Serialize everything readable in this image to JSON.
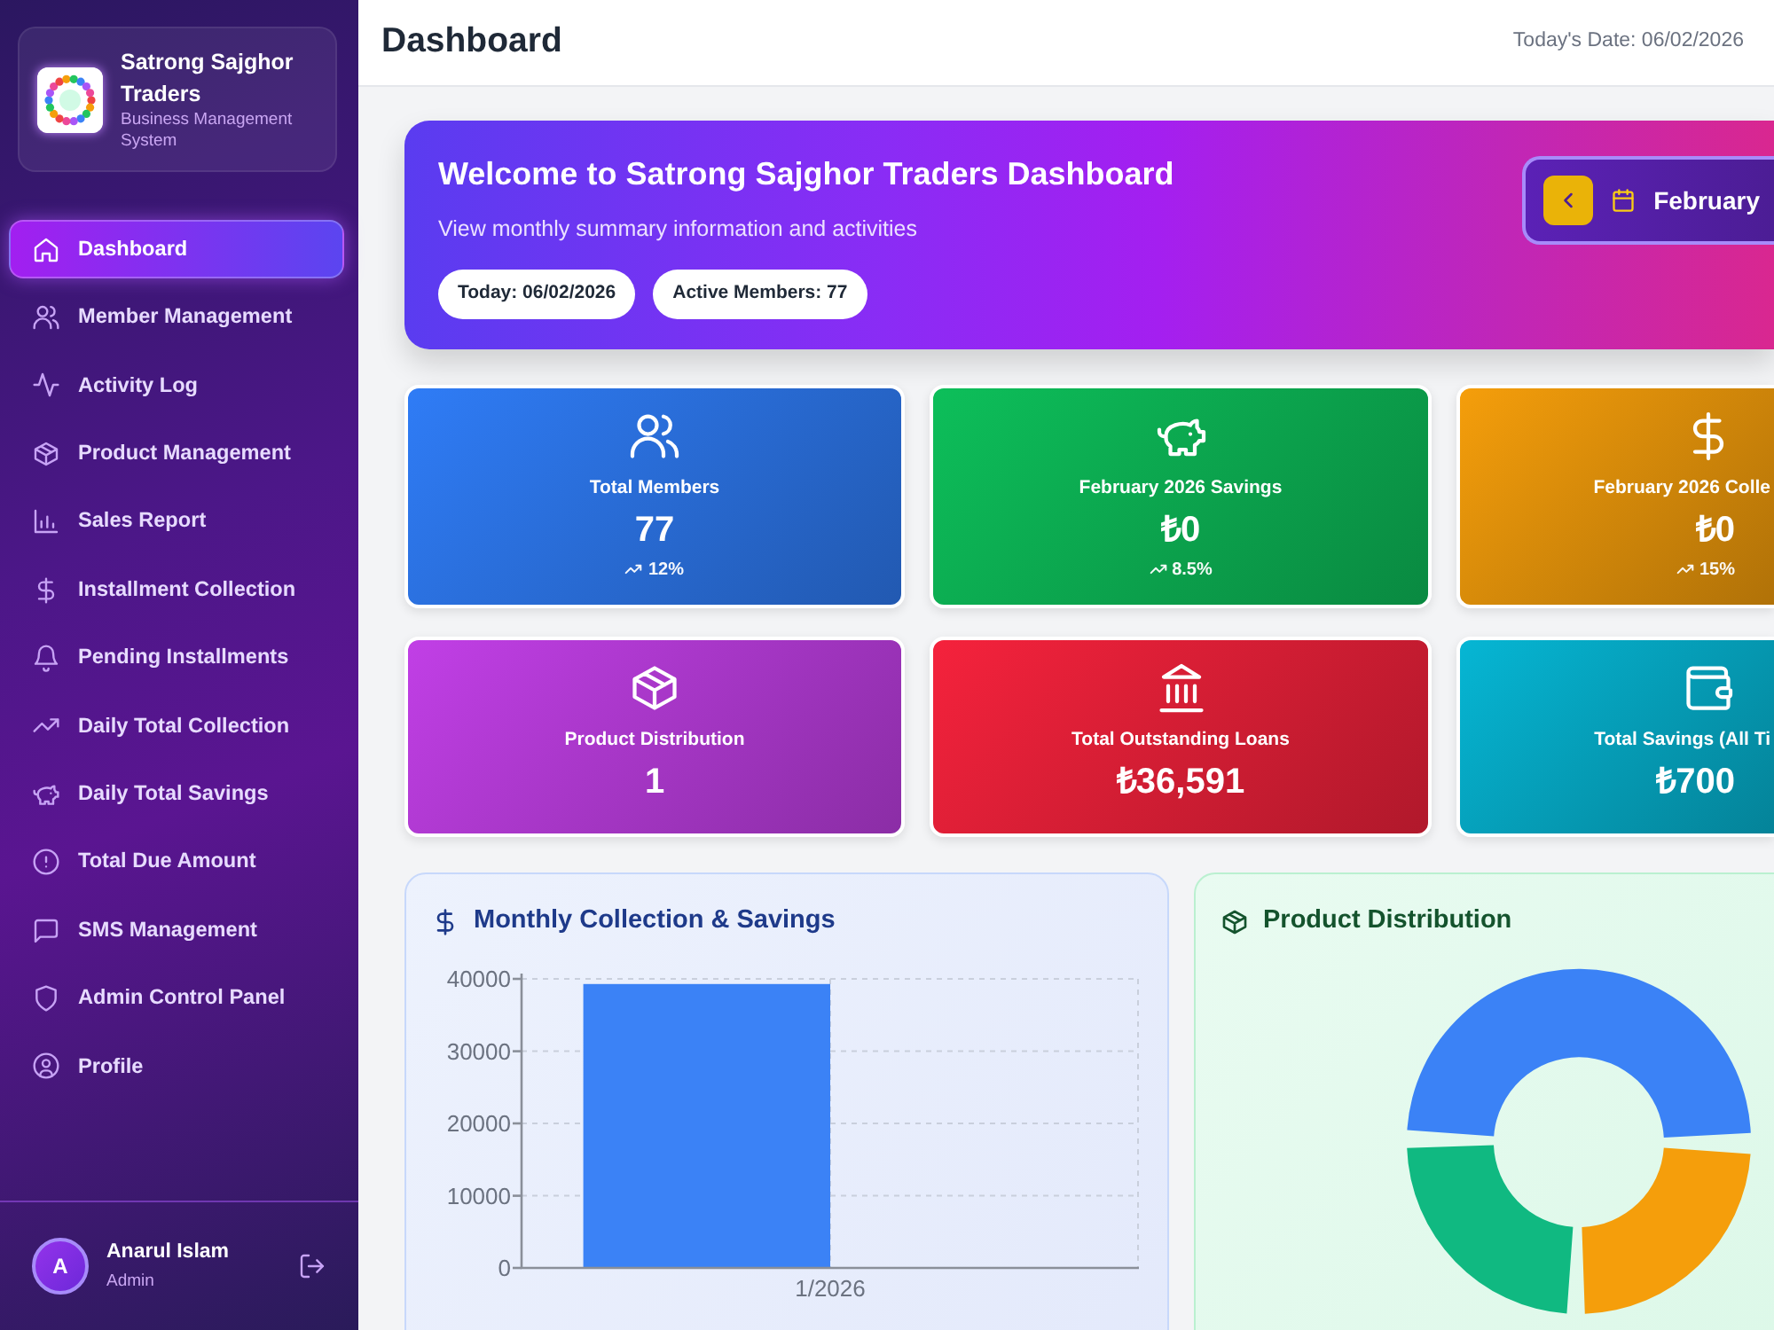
{
  "sidebar": {
    "brand": {
      "name": "Satrong Sajghor Traders",
      "subtitle": "Business Management System"
    },
    "items": [
      {
        "label": "Dashboard",
        "selected": true
      },
      {
        "label": "Member Management",
        "selected": false
      },
      {
        "label": "Activity Log",
        "selected": false
      },
      {
        "label": "Product Management",
        "selected": false
      },
      {
        "label": "Sales Report",
        "selected": false
      },
      {
        "label": "Installment Collection",
        "selected": false
      },
      {
        "label": "Pending Installments",
        "selected": false
      },
      {
        "label": "Daily Total Collection",
        "selected": false
      },
      {
        "label": "Daily Total Savings",
        "selected": false
      },
      {
        "label": "Total Due Amount",
        "selected": false
      },
      {
        "label": "SMS Management",
        "selected": false
      },
      {
        "label": "Admin Control Panel",
        "selected": false
      },
      {
        "label": "Profile",
        "selected": false
      }
    ],
    "user": {
      "initial": "A",
      "name": "Anarul Islam",
      "role": "Admin"
    }
  },
  "header": {
    "title": "Dashboard",
    "date": "Today's Date: 06/02/2026"
  },
  "hero": {
    "title": "Welcome to Satrong Sajghor Traders Dashboard",
    "subtitle": "View monthly summary information and activities",
    "badges": [
      "Today: 06/02/2026",
      "Active Members: 77"
    ],
    "month": "February"
  },
  "stat_cards": [
    {
      "title": "Total Members",
      "value": "77",
      "trend": "12%",
      "color": "#2f7cf6"
    },
    {
      "title": "February 2026 Savings",
      "value": "₺0",
      "trend": "8.5%",
      "color": "#0dbf5a"
    },
    {
      "title": "February 2026 Colle",
      "value": "₺0",
      "trend": "15%",
      "color": "#f59e0b"
    },
    {
      "title": "Product Distribution",
      "value": "1",
      "color": "#c13fe6"
    },
    {
      "title": "Total Outstanding Loans",
      "value": "₺36,591",
      "color": "#f5223c"
    },
    {
      "title": "Total Savings (All Ti",
      "value": "₺700",
      "color": "#06b6d4"
    }
  ],
  "collection_panel": {
    "chart_data": {
      "type": "bar",
      "title": "Monthly Collection & Savings",
      "categories": [
        "1/2026"
      ],
      "values": [
        39300
      ],
      "ylim": [
        0,
        40000
      ],
      "grid": true,
      "yticks": [
        0,
        10000,
        20000,
        30000,
        40000
      ]
    }
  },
  "distribution_panel": {
    "title": "Product Distribution"
  }
}
